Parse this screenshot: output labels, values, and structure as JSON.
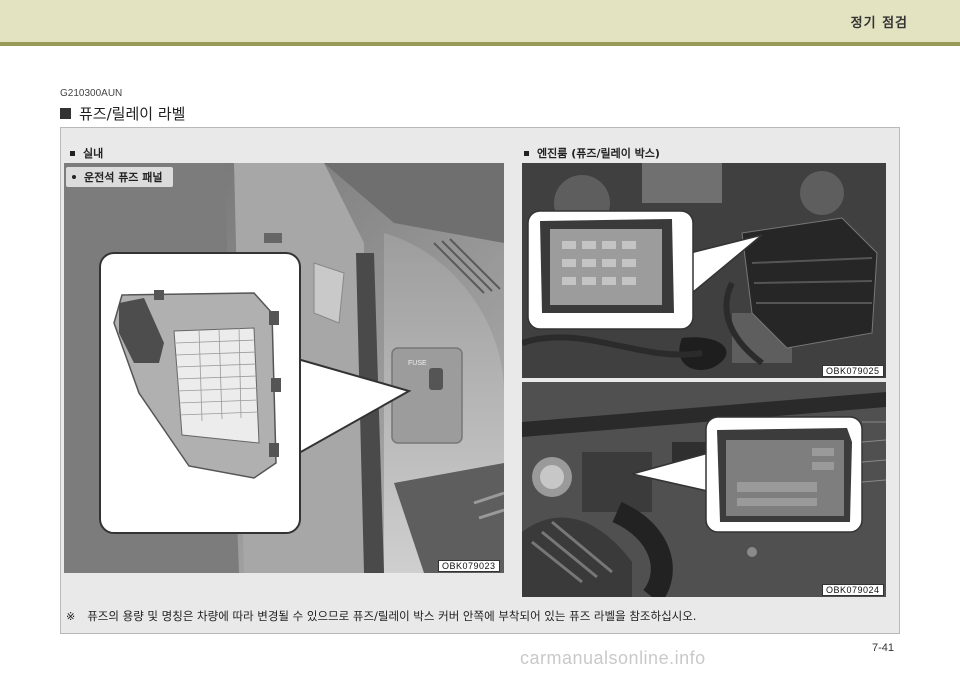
{
  "header": {
    "title": "정기 점검"
  },
  "section": {
    "code": "G210300AUN",
    "title": "퓨즈/릴레이 라벨"
  },
  "left_panel": {
    "label": "실내",
    "sublabel": "운전석 퓨즈 패널",
    "fuse_text": "FUSE",
    "image_code": "OBK079023"
  },
  "right_panel": {
    "label": "엔진룸 (퓨즈/릴레이 박스)",
    "image_code_top": "OBK079025",
    "image_code_bottom": "OBK079024"
  },
  "note": {
    "mark": "※",
    "text": "퓨즈의 용량 및 명칭은 차량에 따라 변경될 수 있으므로 퓨즈/릴레이 박스 커버 안쪽에 부착되어 있는 퓨즈 라벨을 참조하십시오."
  },
  "page_number": "7-41",
  "watermark": "carmanualsonline.info"
}
